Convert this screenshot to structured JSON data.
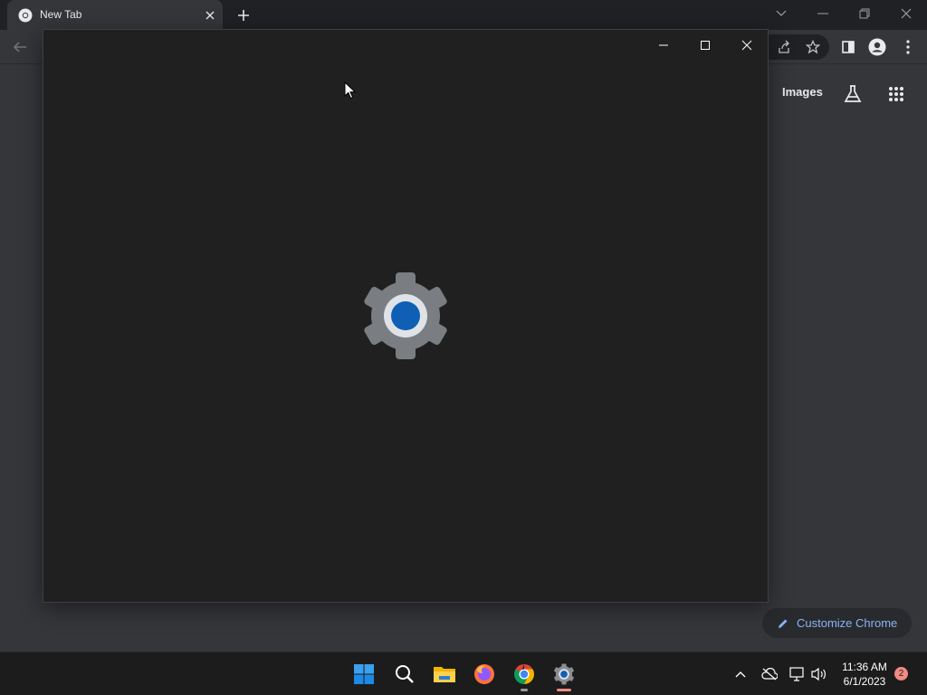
{
  "browser": {
    "tab": {
      "title": "New Tab"
    },
    "ntp": {
      "images_link": "Images",
      "customize_label": "Customize Chrome"
    }
  },
  "settings_window": {
    "controls": [
      "minimize",
      "maximize",
      "close"
    ],
    "splash_icon": "settings-gear-icon"
  },
  "taskbar": {
    "apps": [
      "start-icon",
      "search-icon",
      "file-explorer-icon",
      "firefox-icon",
      "chrome-icon",
      "settings-icon"
    ],
    "clock": {
      "time": "11:36 AM",
      "date": "6/1/2023"
    },
    "notification_count": "2"
  },
  "colors": {
    "accent_blue": "#8ab4f8",
    "gear_blue": "#0f5fb5",
    "badge": "#f28b82"
  }
}
